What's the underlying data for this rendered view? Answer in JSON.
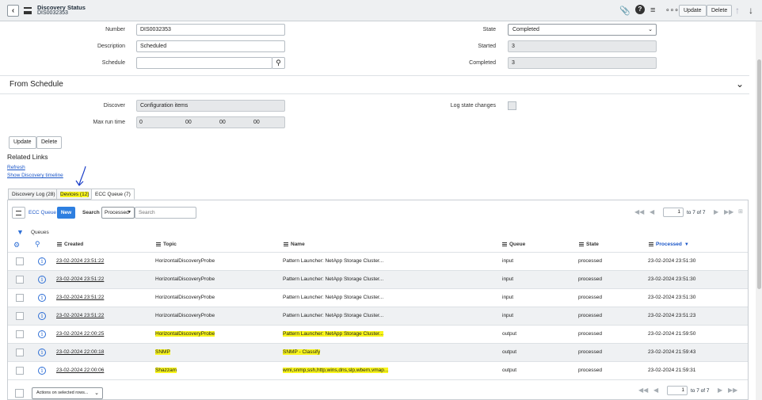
{
  "header": {
    "title": "Discovery Status",
    "subtitle": "DIS0032353",
    "update_label": "Update",
    "delete_label": "Delete"
  },
  "form": {
    "number_label": "Number",
    "number_value": "DIS0032353",
    "description_label": "Description",
    "description_value": "Scheduled",
    "schedule_label": "Schedule",
    "schedule_value": "",
    "state_label": "State",
    "state_value": "Completed",
    "started_label": "Started",
    "started_value": "3",
    "completed_label": "Completed",
    "completed_value": "3"
  },
  "section": {
    "title": "From Schedule",
    "discover_label": "Discover",
    "discover_value": "Configuration items",
    "maxrun_label": "Max run time",
    "maxrun_days": "0",
    "maxrun_h": "00",
    "maxrun_m": "00",
    "maxrun_s": "00",
    "logstate_label": "Log state changes"
  },
  "buttons": {
    "update": "Update",
    "delete": "Delete"
  },
  "related": {
    "title": "Related Links",
    "refresh": "Refresh",
    "timeline": "Show Discovery timeline"
  },
  "tabs": [
    "Discovery Log (28)",
    "Devices (12)",
    "ECC Queue (7)"
  ],
  "list": {
    "title": "ECC Queue",
    "new_label": "New",
    "search_label": "Search",
    "search_field": "Processed",
    "search_placeholder": "Search",
    "page_value": "1",
    "page_of": "to 7 of 7",
    "queues_label": "Queues",
    "columns": [
      "Created",
      "Topic",
      "Name",
      "Queue",
      "State",
      "Processed"
    ],
    "rows": [
      {
        "created": "23-02-2024 23:51:22",
        "topic": "HorizontalDiscoveryProbe",
        "name": "Pattern Launcher: NetApp Storage Cluster...",
        "queue": "input",
        "state": "processed",
        "processed": "23-02-2024 23:51:30"
      },
      {
        "created": "23-02-2024 23:51:22",
        "topic": "HorizontalDiscoveryProbe",
        "name": "Pattern Launcher: NetApp Storage Cluster...",
        "queue": "input",
        "state": "processed",
        "processed": "23-02-2024 23:51:30"
      },
      {
        "created": "23-02-2024 23:51:22",
        "topic": "HorizontalDiscoveryProbe",
        "name": "Pattern Launcher: NetApp Storage Cluster...",
        "queue": "input",
        "state": "processed",
        "processed": "23-02-2024 23:51:30"
      },
      {
        "created": "23-02-2024 23:51:22",
        "topic": "HorizontalDiscoveryProbe",
        "name": "Pattern Launcher: NetApp Storage Cluster...",
        "queue": "input",
        "state": "processed",
        "processed": "23-02-2024 23:51:23"
      },
      {
        "created": "23-02-2024 22:00:25",
        "topic": "HorizontalDiscoveryProbe",
        "name": "Pattern Launcher: NetApp Storage Cluster...",
        "queue": "output",
        "state": "processed",
        "processed": "23-02-2024 21:59:50"
      },
      {
        "created": "23-02-2024 22:00:18",
        "topic": "SNMP",
        "name": "SNMP - Classify",
        "queue": "output",
        "state": "processed",
        "processed": "23-02-2024 21:59:43"
      },
      {
        "created": "23-02-2024 22:00:06",
        "topic": "Shazzam",
        "name": "wmi,snmp,ssh,http,wins,dns,slp,wbem,vmap...",
        "queue": "output",
        "state": "processed",
        "processed": "23-02-2024 21:59:31"
      }
    ],
    "actions_label": "Actions on selected rows...",
    "highlight_color": "#f8f51b"
  }
}
